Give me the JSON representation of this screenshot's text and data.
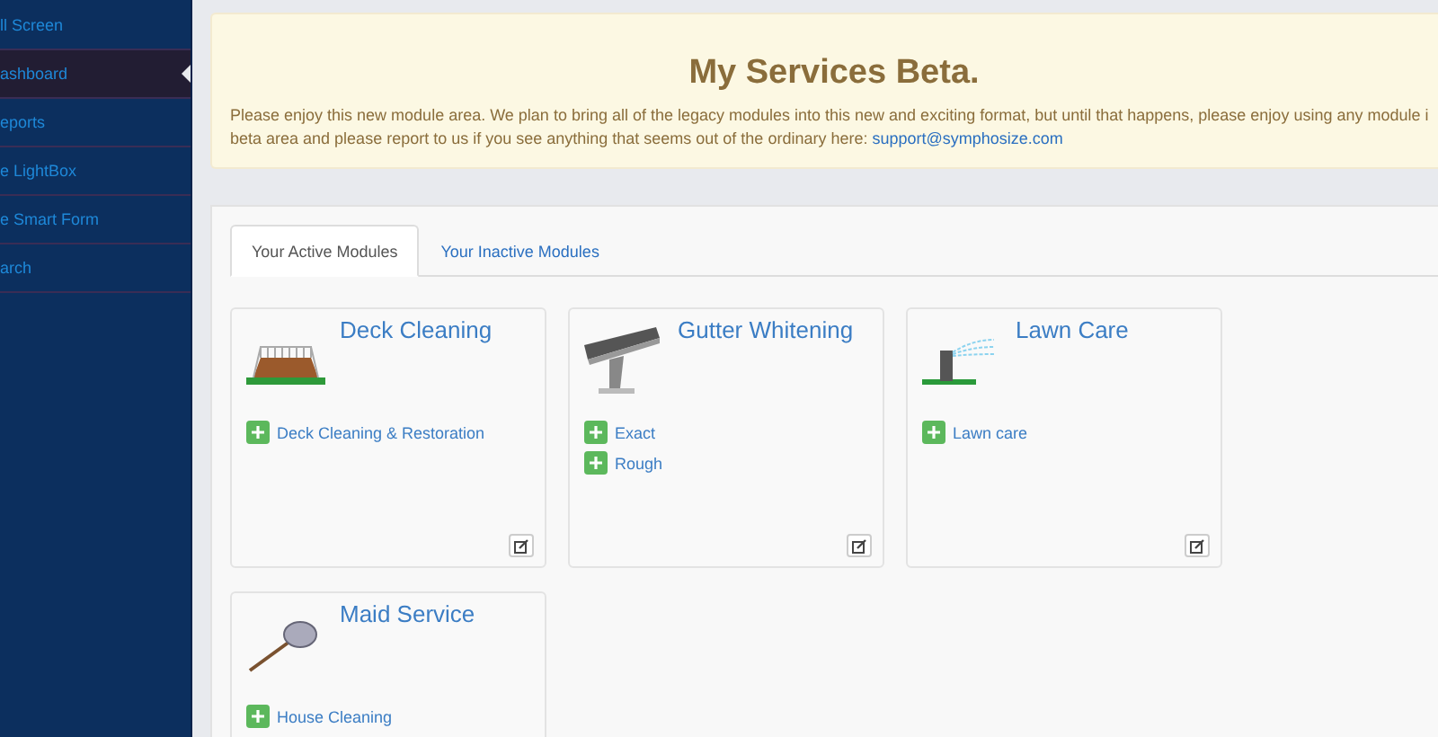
{
  "sidebar": {
    "items": [
      {
        "label": "ll Screen",
        "selected": false
      },
      {
        "label": "ashboard",
        "selected": true
      },
      {
        "label": "eports",
        "selected": false
      },
      {
        "label": "e LightBox",
        "selected": false
      },
      {
        "label": "e Smart Form",
        "selected": false
      },
      {
        "label": "arch",
        "selected": false
      }
    ]
  },
  "notice": {
    "title": "My Services Beta.",
    "text": "Please enjoy this new module area. We plan to bring all of the legacy modules into this new and exciting format, but until that happens, please enjoy using any module i\nbeta area and please report to us if you see anything that seems out of the ordinary here: ",
    "link": "support@symphosize.com"
  },
  "tabs": [
    {
      "label": "Your Active Modules",
      "selected": true
    },
    {
      "label": "Your Inactive Modules",
      "selected": false
    }
  ],
  "modules": [
    {
      "title": "Deck Cleaning",
      "kind": "deck",
      "services": [
        "Deck Cleaning & Restoration"
      ]
    },
    {
      "title": "Gutter Whitening",
      "kind": "gutter",
      "services": [
        "Exact",
        "Rough"
      ]
    },
    {
      "title": "Lawn Care",
      "kind": "lawn",
      "services": [
        "Lawn care"
      ]
    },
    {
      "title": "Maid Service",
      "kind": "maid",
      "services": [
        "House Cleaning"
      ]
    }
  ]
}
